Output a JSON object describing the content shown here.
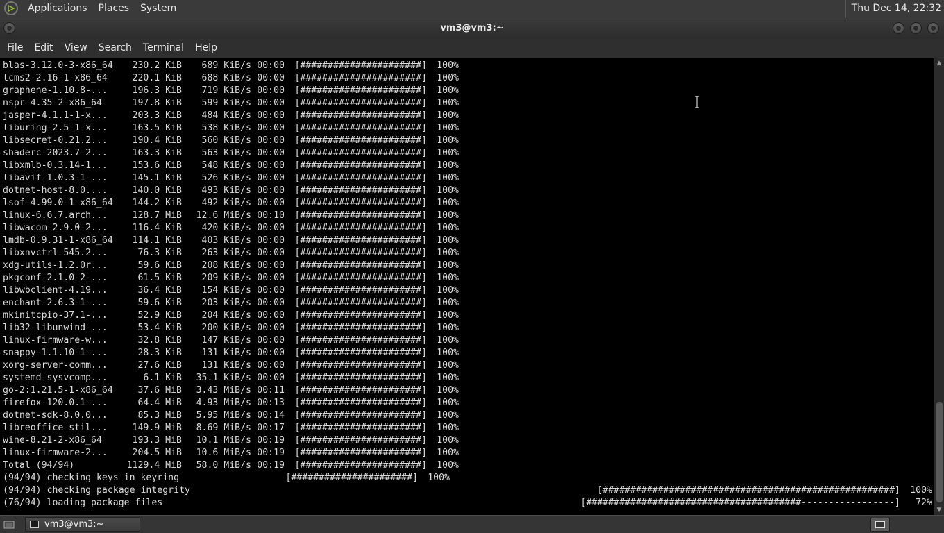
{
  "top_panel": {
    "menus": [
      "Applications",
      "Places",
      "System"
    ],
    "clock": "Thu Dec 14, 22:32"
  },
  "window": {
    "title": "vm3@vm3:~",
    "menu": [
      "File",
      "Edit",
      "View",
      "Search",
      "Terminal",
      "Help"
    ]
  },
  "terminal": {
    "downloads": [
      {
        "name": "blas-3.12.0-3-x86_64",
        "size": "230.2 KiB",
        "speed": "689 KiB/s",
        "time": "00:00",
        "bar": "[######################]",
        "pct": "100%"
      },
      {
        "name": "lcms2-2.16-1-x86_64",
        "size": "220.1 KiB",
        "speed": "688 KiB/s",
        "time": "00:00",
        "bar": "[######################]",
        "pct": "100%"
      },
      {
        "name": "graphene-1.10.8-...",
        "size": "196.3 KiB",
        "speed": "719 KiB/s",
        "time": "00:00",
        "bar": "[######################]",
        "pct": "100%"
      },
      {
        "name": "nspr-4.35-2-x86_64",
        "size": "197.8 KiB",
        "speed": "599 KiB/s",
        "time": "00:00",
        "bar": "[######################]",
        "pct": "100%"
      },
      {
        "name": "jasper-4.1.1-1-x...",
        "size": "203.3 KiB",
        "speed": "484 KiB/s",
        "time": "00:00",
        "bar": "[######################]",
        "pct": "100%"
      },
      {
        "name": "liburing-2.5-1-x...",
        "size": "163.5 KiB",
        "speed": "538 KiB/s",
        "time": "00:00",
        "bar": "[######################]",
        "pct": "100%"
      },
      {
        "name": "libsecret-0.21.2...",
        "size": "190.4 KiB",
        "speed": "560 KiB/s",
        "time": "00:00",
        "bar": "[######################]",
        "pct": "100%"
      },
      {
        "name": "shaderc-2023.7-2...",
        "size": "163.3 KiB",
        "speed": "563 KiB/s",
        "time": "00:00",
        "bar": "[######################]",
        "pct": "100%"
      },
      {
        "name": "libxmlb-0.3.14-1...",
        "size": "153.6 KiB",
        "speed": "548 KiB/s",
        "time": "00:00",
        "bar": "[######################]",
        "pct": "100%"
      },
      {
        "name": "libavif-1.0.3-1-...",
        "size": "145.1 KiB",
        "speed": "526 KiB/s",
        "time": "00:00",
        "bar": "[######################]",
        "pct": "100%"
      },
      {
        "name": "dotnet-host-8.0....",
        "size": "140.0 KiB",
        "speed": "493 KiB/s",
        "time": "00:00",
        "bar": "[######################]",
        "pct": "100%"
      },
      {
        "name": "lsof-4.99.0-1-x86_64",
        "size": "144.2 KiB",
        "speed": "492 KiB/s",
        "time": "00:00",
        "bar": "[######################]",
        "pct": "100%"
      },
      {
        "name": "linux-6.6.7.arch...",
        "size": "128.7 MiB",
        "speed": "12.6 MiB/s",
        "time": "00:10",
        "bar": "[######################]",
        "pct": "100%"
      },
      {
        "name": "libwacom-2.9.0-2...",
        "size": "116.4 KiB",
        "speed": "420 KiB/s",
        "time": "00:00",
        "bar": "[######################]",
        "pct": "100%"
      },
      {
        "name": "lmdb-0.9.31-1-x86_64",
        "size": "114.1 KiB",
        "speed": "403 KiB/s",
        "time": "00:00",
        "bar": "[######################]",
        "pct": "100%"
      },
      {
        "name": "libxnvctrl-545.2...",
        "size": "76.3 KiB",
        "speed": "263 KiB/s",
        "time": "00:00",
        "bar": "[######################]",
        "pct": "100%"
      },
      {
        "name": "xdg-utils-1.2.0r...",
        "size": "59.6 KiB",
        "speed": "208 KiB/s",
        "time": "00:00",
        "bar": "[######################]",
        "pct": "100%"
      },
      {
        "name": "pkgconf-2.1.0-2-...",
        "size": "61.5 KiB",
        "speed": "209 KiB/s",
        "time": "00:00",
        "bar": "[######################]",
        "pct": "100%"
      },
      {
        "name": "libwbclient-4.19...",
        "size": "36.4 KiB",
        "speed": "154 KiB/s",
        "time": "00:00",
        "bar": "[######################]",
        "pct": "100%"
      },
      {
        "name": "enchant-2.6.3-1-...",
        "size": "59.6 KiB",
        "speed": "203 KiB/s",
        "time": "00:00",
        "bar": "[######################]",
        "pct": "100%"
      },
      {
        "name": "mkinitcpio-37.1-...",
        "size": "52.9 KiB",
        "speed": "204 KiB/s",
        "time": "00:00",
        "bar": "[######################]",
        "pct": "100%"
      },
      {
        "name": "lib32-libunwind-...",
        "size": "53.4 KiB",
        "speed": "200 KiB/s",
        "time": "00:00",
        "bar": "[######################]",
        "pct": "100%"
      },
      {
        "name": "linux-firmware-w...",
        "size": "32.8 KiB",
        "speed": "147 KiB/s",
        "time": "00:00",
        "bar": "[######################]",
        "pct": "100%"
      },
      {
        "name": "snappy-1.1.10-1-...",
        "size": "28.3 KiB",
        "speed": "131 KiB/s",
        "time": "00:00",
        "bar": "[######################]",
        "pct": "100%"
      },
      {
        "name": "xorg-server-comm...",
        "size": "27.6 KiB",
        "speed": "131 KiB/s",
        "time": "00:00",
        "bar": "[######################]",
        "pct": "100%"
      },
      {
        "name": "systemd-sysvcomp...",
        "size": "6.1 KiB",
        "speed": "35.1 KiB/s",
        "time": "00:00",
        "bar": "[######################]",
        "pct": "100%"
      },
      {
        "name": "go-2:1.21.5-1-x86_64",
        "size": "37.6 MiB",
        "speed": "3.43 MiB/s",
        "time": "00:11",
        "bar": "[######################]",
        "pct": "100%"
      },
      {
        "name": "firefox-120.0.1-...",
        "size": "64.4 MiB",
        "speed": "4.93 MiB/s",
        "time": "00:13",
        "bar": "[######################]",
        "pct": "100%"
      },
      {
        "name": "dotnet-sdk-8.0.0...",
        "size": "85.3 MiB",
        "speed": "5.95 MiB/s",
        "time": "00:14",
        "bar": "[######################]",
        "pct": "100%"
      },
      {
        "name": "libreoffice-stil...",
        "size": "149.9 MiB",
        "speed": "8.69 MiB/s",
        "time": "00:17",
        "bar": "[######################]",
        "pct": "100%"
      },
      {
        "name": "wine-8.21-2-x86_64",
        "size": "193.3 MiB",
        "speed": "10.1 MiB/s",
        "time": "00:19",
        "bar": "[######################]",
        "pct": "100%"
      },
      {
        "name": "linux-firmware-2...",
        "size": "204.5 MiB",
        "speed": "10.6 MiB/s",
        "time": "00:19",
        "bar": "[######################]",
        "pct": "100%"
      },
      {
        "name": "Total (94/94)",
        "size": "1129.4 MiB",
        "speed": "58.0 MiB/s",
        "time": "00:19",
        "bar": "[######################]",
        "pct": "100%"
      }
    ],
    "keys_line": {
      "text": "(94/94) checking keys in keyring",
      "bar": "[######################]",
      "pct": "100%"
    },
    "integrity_line": {
      "text": "(94/94) checking package integrity",
      "bar": "[#####################################################]",
      "pct": "100%"
    },
    "loading_line": {
      "text": "(76/94) loading package files",
      "bar": "[#######################################-----------------]",
      "pct": "72%"
    }
  },
  "taskbar": {
    "window_button": "vm3@vm3:~"
  },
  "colors": {
    "panel_bg": "#3a3a3a",
    "terminal_bg": "#000000",
    "terminal_fg": "#d8d8d8"
  }
}
